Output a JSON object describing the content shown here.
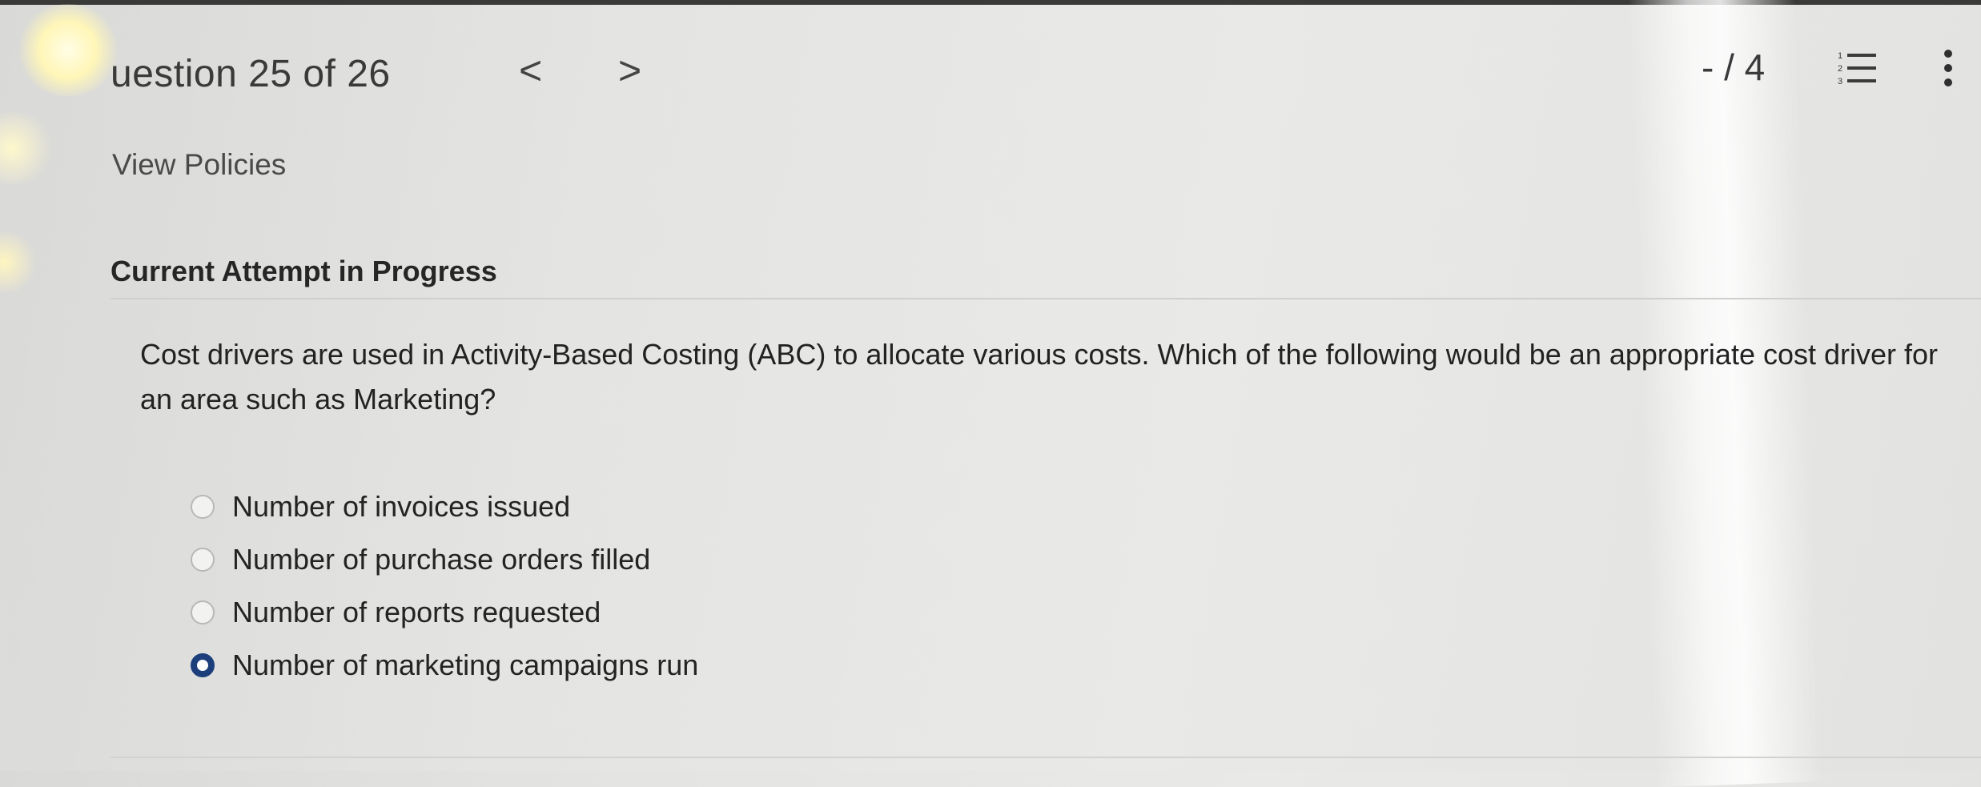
{
  "header": {
    "question_counter": "uestion 25 of 26",
    "prev_symbol": "<",
    "next_symbol": ">",
    "score": "- / 4"
  },
  "links": {
    "view_policies": "View Policies"
  },
  "attempt": {
    "status": "Current Attempt in Progress"
  },
  "question": {
    "text": "Cost drivers are used in Activity-Based Costing (ABC) to allocate various costs. Which of the following would be an appropriate cost driver for an area such as Marketing?",
    "options": [
      {
        "label": "Number of invoices issued",
        "selected": false
      },
      {
        "label": "Number of purchase orders filled",
        "selected": false
      },
      {
        "label": "Number of reports requested",
        "selected": false
      },
      {
        "label": "Number of marketing campaigns run",
        "selected": true
      }
    ]
  },
  "icons": {
    "list": "numbered-list-icon",
    "more": "more-vertical-icon",
    "prev": "chevron-left-icon",
    "next": "chevron-right-icon"
  },
  "colors": {
    "selected_radio": "#1c3f7c",
    "background": "#e6e6e4"
  }
}
